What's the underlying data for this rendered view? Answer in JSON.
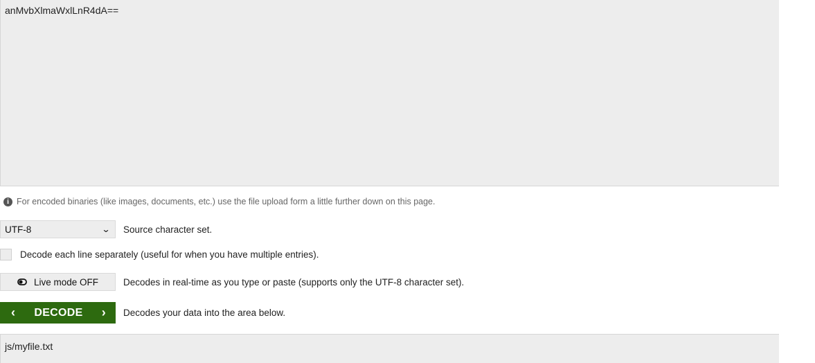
{
  "input": {
    "value": "anMvbXlmaWxlLnR4dA=="
  },
  "info": {
    "text": "For encoded binaries (like images, documents, etc.) use the file upload form a little further down on this page.",
    "icon": "info-circle-icon"
  },
  "charset": {
    "selected": "UTF-8",
    "label": "Source character set."
  },
  "line_option": {
    "checked": false,
    "label": "Decode each line separately (useful for when you have multiple entries)."
  },
  "live_mode": {
    "button_label": "Live mode OFF",
    "description": "Decodes in real-time as you type or paste (supports only the UTF-8 character set)."
  },
  "decode": {
    "button_label": "DECODE",
    "description": "Decodes your data into the area below.",
    "color": "#2d6a0f"
  },
  "output": {
    "value": "js/myfile.txt"
  }
}
